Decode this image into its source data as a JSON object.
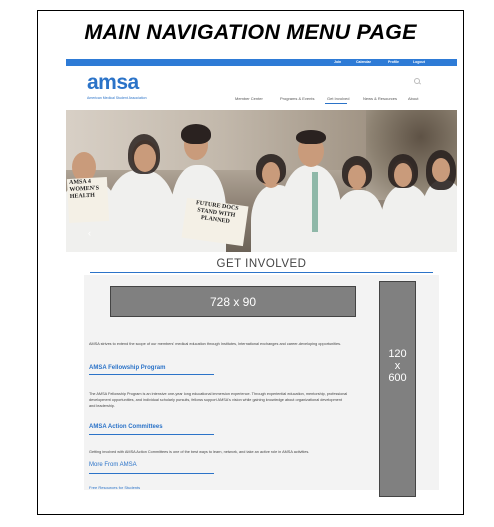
{
  "heading": "MAIN NAVIGATION MENU PAGE",
  "topbar": {
    "join": "Join",
    "calendar": "Calendar",
    "profile": "Profile",
    "logout": "Logout"
  },
  "logo": {
    "word": "amsa",
    "sub": "American Medical Student Association"
  },
  "nav": {
    "member_center": "Member Center",
    "programs_events": "Programs & Events",
    "get_involved": "Get Involved",
    "news_resources": "News & Resources",
    "about": "About"
  },
  "hero": {
    "sign_left": "AMSA 4 WOMEN'S HEALTH",
    "sign_center": "FUTURE DOCS STAND WITH PLANNED"
  },
  "section": {
    "title": "GET INVOLVED"
  },
  "ads": {
    "wide": "728 x 90",
    "tall_1": "120",
    "tall_2": "x",
    "tall_3": "600"
  },
  "content": {
    "intro": "AMSA strives to extend the scope of our members' medical education through Institutes, International exchanges and career-developing opportunities.",
    "fellowship_title": "AMSA Fellowship Program",
    "fellowship_text": "The AMSA Fellowship Program is an intensive one-year long educational immersion experience. Through experiential education, mentorship, professional development opportunities, and individual scholarly pursuits, fellows support AMSA's vision while gaining knowledge about organizational development and leadership.",
    "committees_title": "AMSA Action Committees",
    "committees_text": "Getting involved with AMSA Action Committees is one of the best ways to learn, network, and take an active role in AMSA activities.",
    "more_title": "More From AMSA",
    "free_resources": "Free Resources for Students"
  },
  "colors": {
    "brand_blue": "#2b73c8",
    "ad_gray": "#808080"
  }
}
